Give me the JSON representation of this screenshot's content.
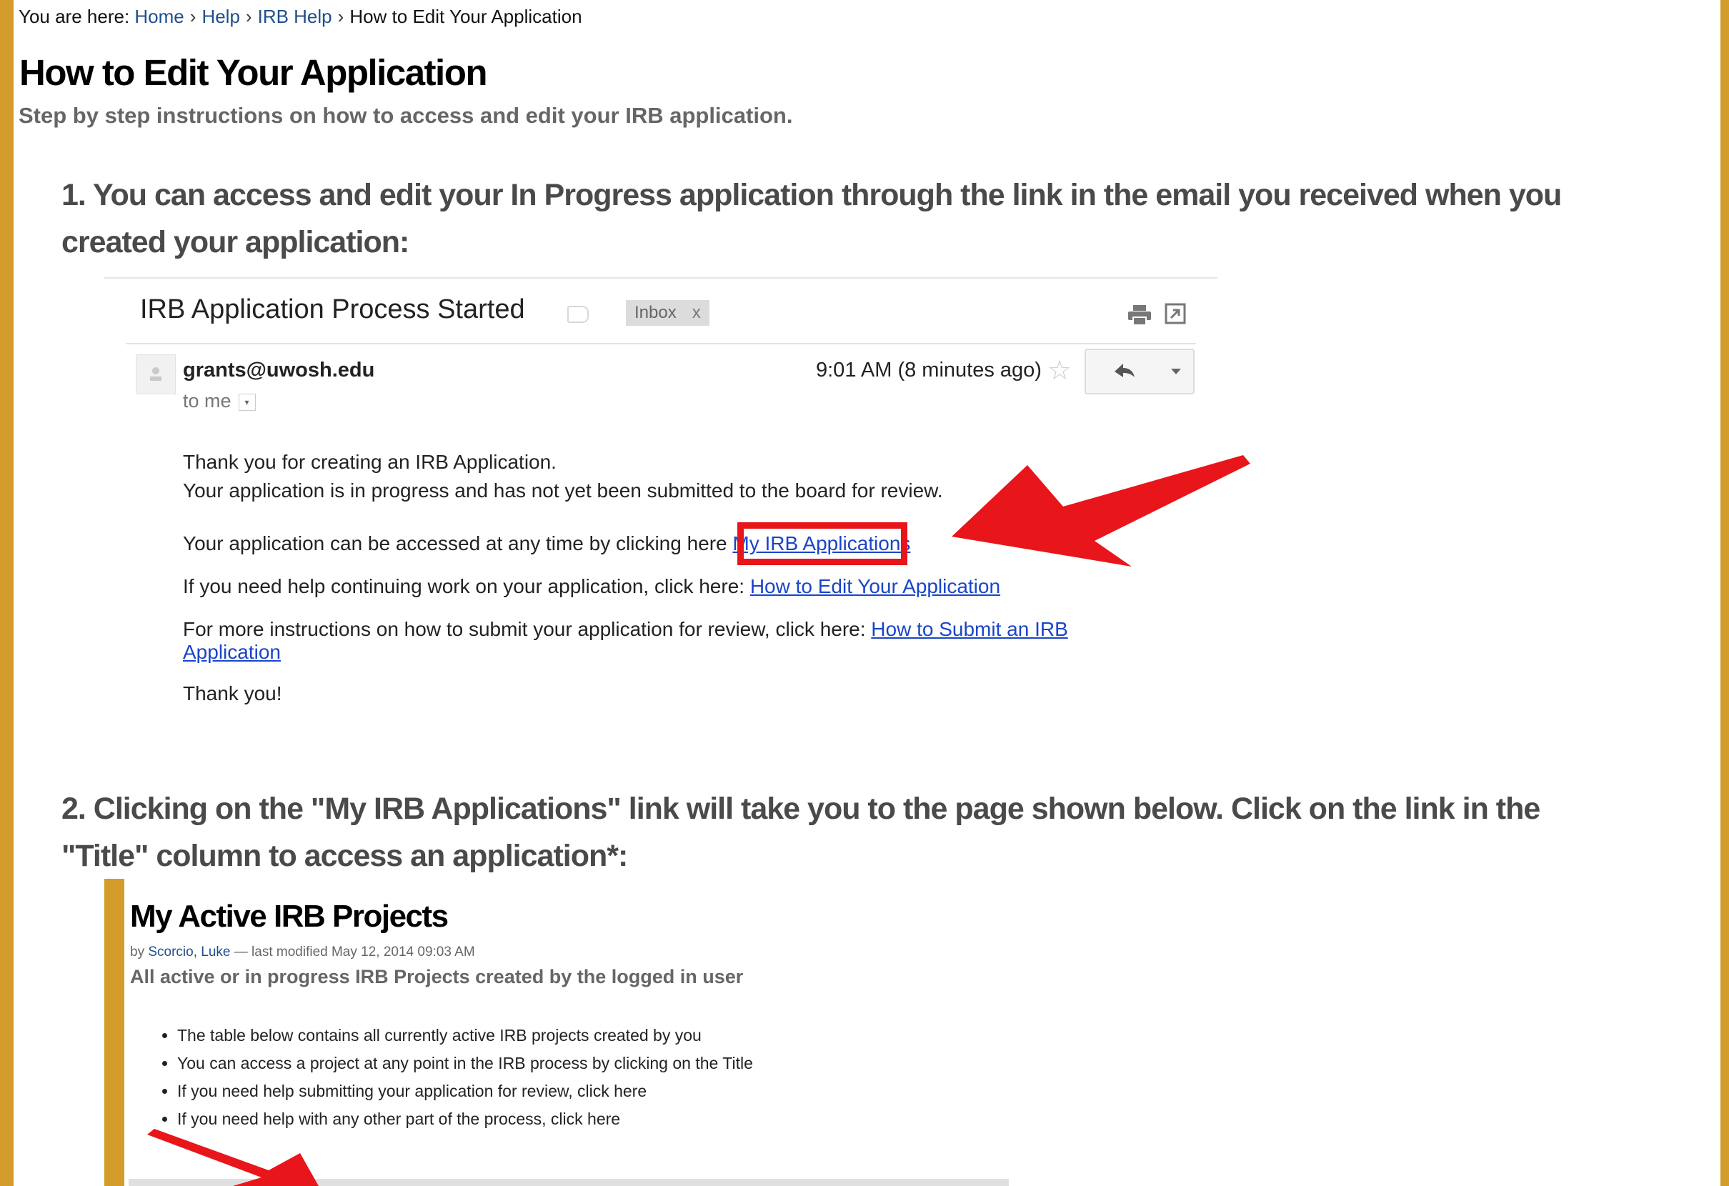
{
  "breadcrumb": {
    "prefix": "You are here:",
    "items": [
      "Home",
      "Help",
      "IRB Help"
    ],
    "current": "How to Edit Your Application",
    "separator": "›"
  },
  "page": {
    "title": "How to Edit Your Application",
    "description": "Step by step instructions on how to access and edit your IRB application."
  },
  "steps": [
    {
      "text": "1. You can access and edit your In Progress application through the link in the email you received when you created your application:"
    },
    {
      "text": "2. Clicking on the \"My IRB Applications\" link will take you to the page shown below. Click on the link in the \"Title\" column to access an application*:"
    }
  ],
  "email": {
    "subject": "IRB Application Process Started",
    "label_chip": "Inbox",
    "label_chip_close": "x",
    "sender": "grants@uwosh.edu",
    "to": "to me",
    "timestamp": "9:01 AM (8 minutes ago)",
    "lines": {
      "line1": "Thank you for creating an IRB Application.",
      "line2": "Your application is in progress and has not yet been submitted to the board for review.",
      "line3_prefix": "Your application can be accessed at any time by clicking here",
      "line3_link": "My IRB Applications",
      "line4_prefix": "If you need help continuing work on your application, click here:",
      "line4_link": "How to Edit Your Application",
      "line5_prefix": "For more instructions on how to submit your application for review, click here:",
      "line5_link_a": "How to Submit an IRB",
      "line5_link_b": "Application",
      "line6": "Thank you!"
    }
  },
  "projects": {
    "title": "My Active IRB Projects",
    "by": "by",
    "author": "Scorcio, Luke",
    "modified": "— last modified May 12, 2014 09:03 AM",
    "description": "All active or in progress IRB Projects created by the logged in user",
    "bullets": [
      "The table below contains all currently active IRB projects created by you",
      "You can access a project at any point in the IRB process by clicking on the Title",
      "If you need help submitting your application for review, click here",
      "If you need help with any other part of the process, click here"
    ]
  },
  "colors": {
    "accent_gold": "#d49c2a",
    "link_blue": "#1a45c9",
    "highlight_red": "#e8151b"
  },
  "icons": [
    "label-icon",
    "print-icon",
    "popout-icon",
    "avatar-icon",
    "star-icon",
    "reply-icon",
    "chevron-down-icon",
    "red-arrow-icon"
  ]
}
